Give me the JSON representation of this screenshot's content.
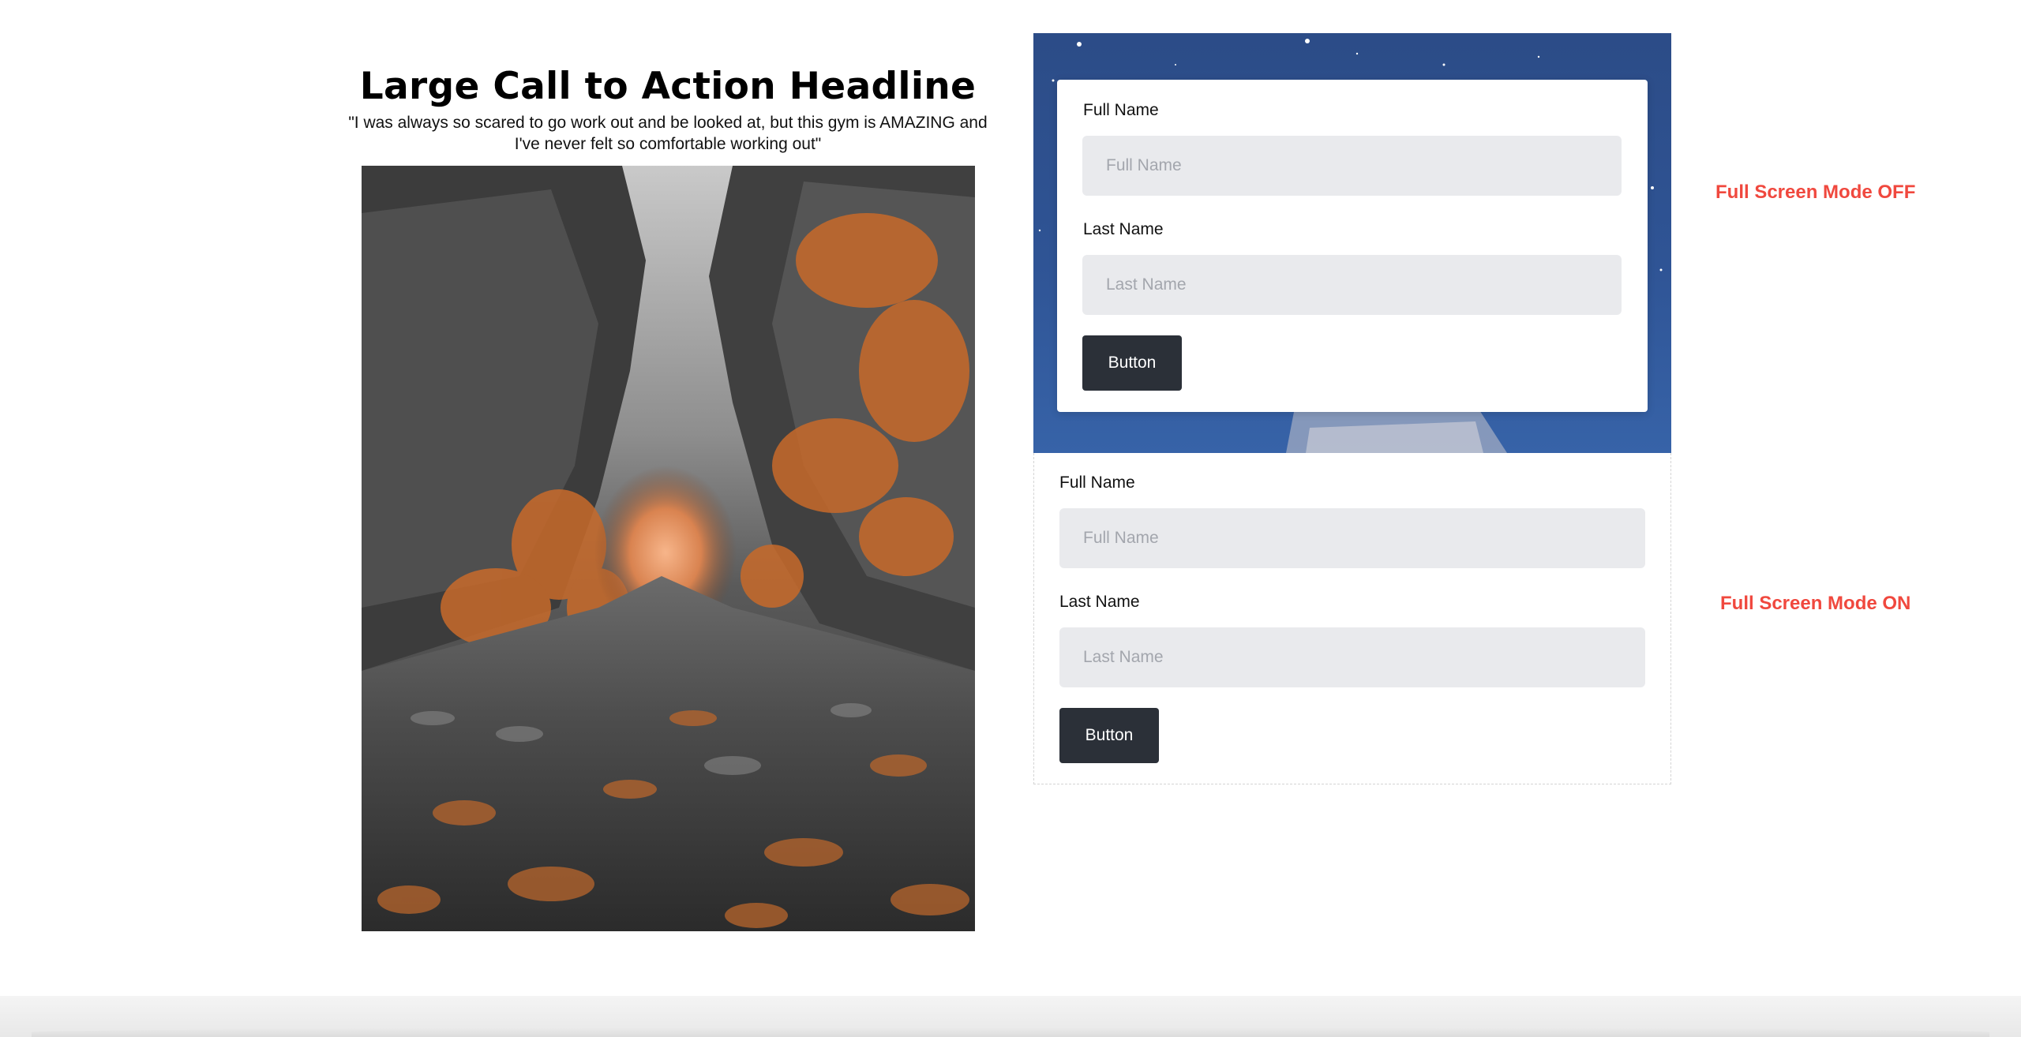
{
  "hero": {
    "title": "Large Call to Action Headline",
    "quote": "\"I was always so scared to go work out and be looked at, but this gym is AMAZING and I've never felt so comfortable working out\"",
    "image_description_icon": "autumn-forest-path-image"
  },
  "form_off": {
    "full_name_label": "Full Name",
    "full_name_placeholder": "Full Name",
    "last_name_label": "Last Name",
    "last_name_placeholder": "Last Name",
    "button_label": "Button"
  },
  "form_on": {
    "full_name_label": "Full Name",
    "full_name_placeholder": "Full Name",
    "last_name_label": "Last Name",
    "last_name_placeholder": "Last Name",
    "button_label": "Button"
  },
  "mode_labels": {
    "off": "Full Screen Mode OFF",
    "on": "Full Screen Mode ON"
  },
  "colors": {
    "accent_label": "#f0483e",
    "button_bg": "#2b3038",
    "input_bg": "#e9eaed",
    "panel_bg": "#2f5495"
  }
}
